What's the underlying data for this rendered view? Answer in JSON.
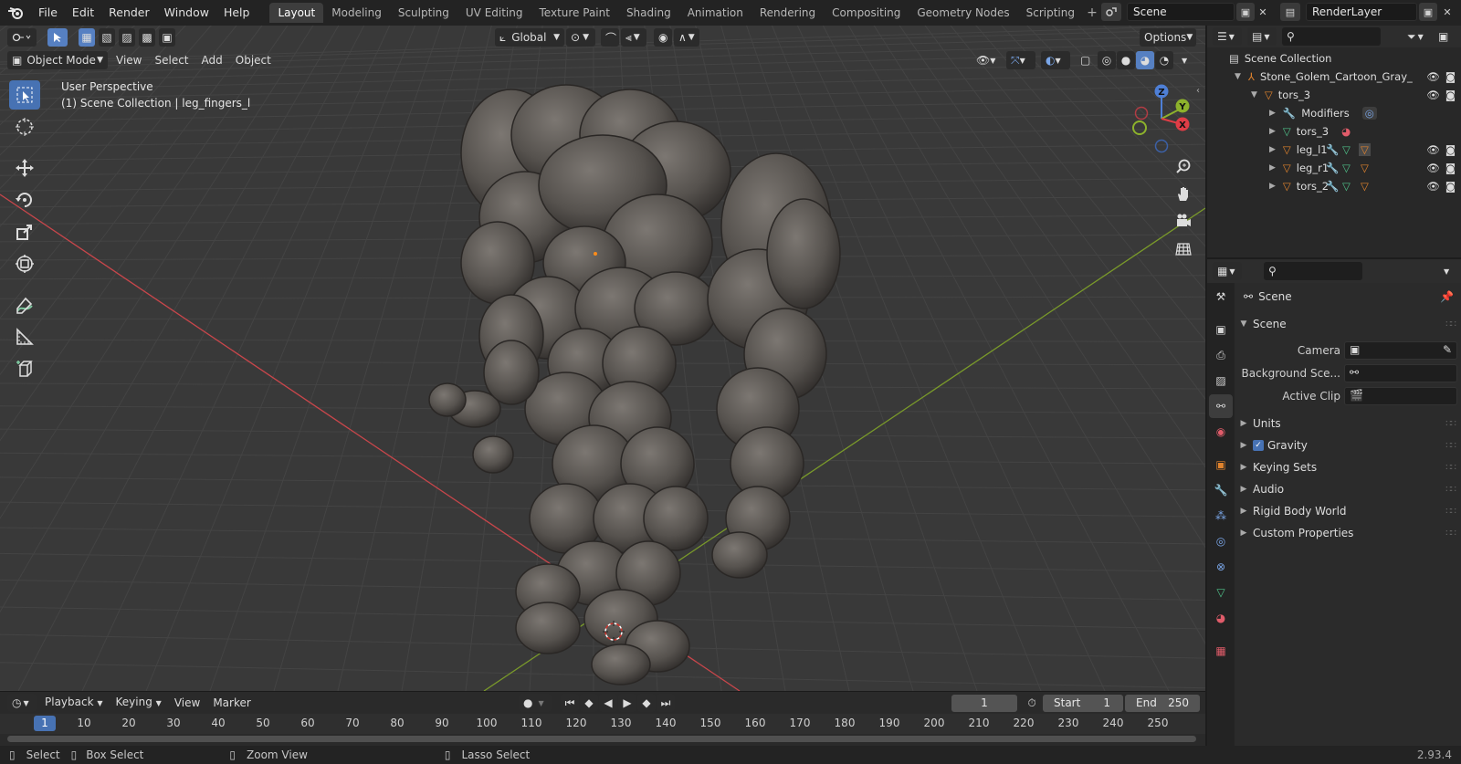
{
  "app": {
    "version": "2.93.4"
  },
  "menubar": {
    "items": [
      "File",
      "Edit",
      "Render",
      "Window",
      "Help"
    ]
  },
  "workspaces": {
    "tabs": [
      "Layout",
      "Modeling",
      "Sculpting",
      "UV Editing",
      "Texture Paint",
      "Shading",
      "Animation",
      "Rendering",
      "Compositing",
      "Geometry Nodes",
      "Scripting"
    ],
    "active": "Layout"
  },
  "scene_selector": {
    "value": "Scene"
  },
  "viewlayer_selector": {
    "value": "RenderLayer"
  },
  "viewport": {
    "transform_orientation": "Global",
    "options_label": "Options",
    "mode": "Object Mode",
    "menus": [
      "View",
      "Select",
      "Add",
      "Object"
    ],
    "info_line1": "User Perspective",
    "info_line2": "(1) Scene Collection | leg_fingers_l",
    "gizmo_axes": {
      "x": "X",
      "y": "Y",
      "z": "Z"
    },
    "colors": {
      "bg": "#393939",
      "grid": "#444444",
      "axis_x": "#c8464b",
      "axis_y": "#7a9a2a",
      "model": "#5a5656"
    }
  },
  "timeline": {
    "menus": [
      "Playback",
      "Keying",
      "View",
      "Marker"
    ],
    "current_frame": "1",
    "start_label": "Start",
    "start_value": "1",
    "end_label": "End",
    "end_value": "250",
    "ruler_ticks": [
      "1",
      "10",
      "20",
      "30",
      "40",
      "50",
      "60",
      "70",
      "80",
      "90",
      "100",
      "110",
      "120",
      "130",
      "140",
      "150",
      "160",
      "170",
      "180",
      "190",
      "200",
      "210",
      "220",
      "230",
      "240",
      "250"
    ]
  },
  "statusbar": {
    "select": "Select",
    "box_select": "Box Select",
    "zoom_view": "Zoom View",
    "lasso_select": "Lasso Select"
  },
  "outliner": {
    "root": "Scene Collection",
    "items": [
      {
        "label": "Stone_Golem_Cartoon_Gray_",
        "icon": "armature-icon"
      },
      {
        "label": "tors_3",
        "icon": "mesh-object-icon"
      },
      {
        "label": "Modifiers",
        "icon": "wrench-icon"
      },
      {
        "label": "tors_3",
        "icon": "mesh-data-icon"
      },
      {
        "label": "leg_l1",
        "icon": "mesh-object-icon"
      },
      {
        "label": "leg_r1",
        "icon": "mesh-object-icon"
      },
      {
        "label": "tors_2",
        "icon": "mesh-object-icon"
      }
    ]
  },
  "properties": {
    "context": "Scene",
    "panel_title": "Scene",
    "fields": [
      {
        "label": "Camera"
      },
      {
        "label": "Background Sce..."
      },
      {
        "label": "Active Clip"
      }
    ],
    "sections": [
      "Units",
      "Gravity",
      "Keying Sets",
      "Audio",
      "Rigid Body World",
      "Custom Properties"
    ],
    "gravity_checked": true,
    "accent": "#4772b3"
  }
}
